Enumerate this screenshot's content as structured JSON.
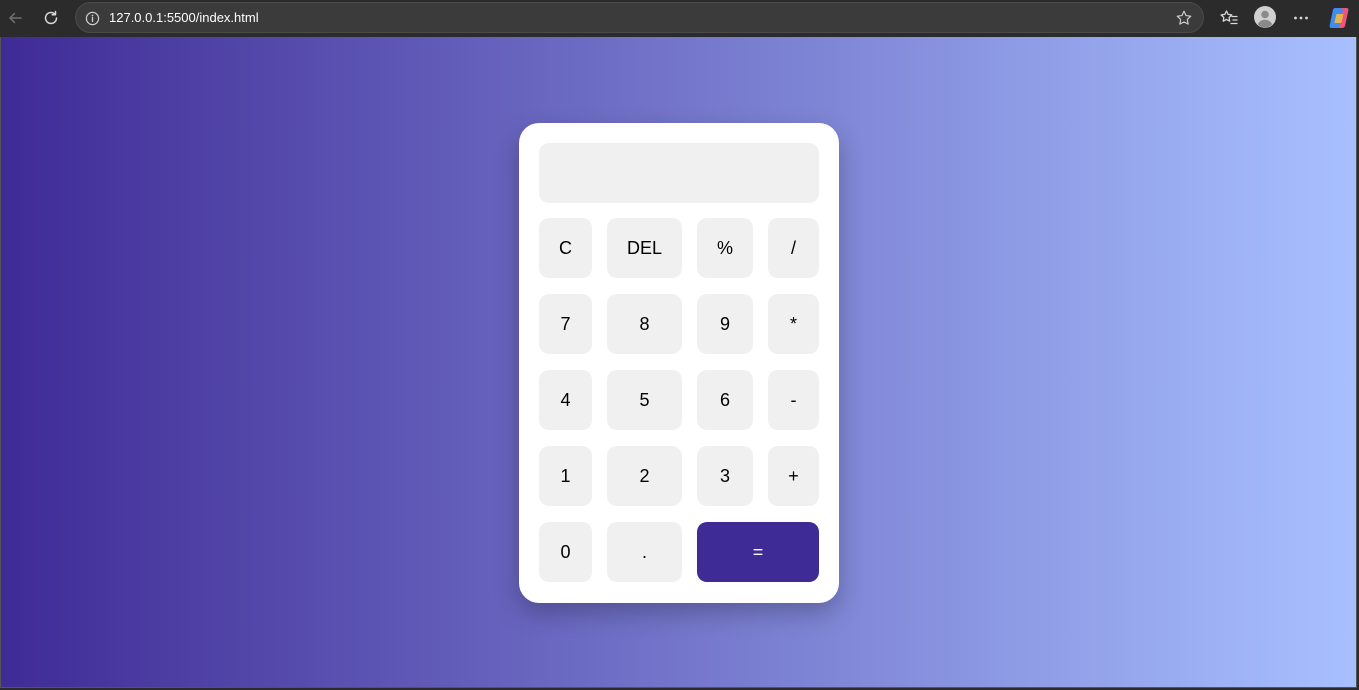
{
  "browser": {
    "url": "127.0.0.1:5500/index.html",
    "icons": {
      "back": "back-arrow-icon",
      "reload": "reload-icon",
      "info": "info-icon",
      "favorite": "star-icon",
      "favorites": "favorites-icon",
      "profile": "profile-avatar-icon",
      "menu": "more-menu-icon",
      "copilot": "copilot-icon"
    }
  },
  "page": {
    "gradient_start": "#3f2b96",
    "gradient_end": "#a8c0ff"
  },
  "calculator": {
    "display_value": "",
    "accent": "#3f2b96",
    "keys": {
      "clear": "C",
      "delete": "DEL",
      "percent": "%",
      "divide": "/",
      "seven": "7",
      "eight": "8",
      "nine": "9",
      "multiply": "*",
      "four": "4",
      "five": "5",
      "six": "6",
      "subtract": "-",
      "one": "1",
      "two": "2",
      "three": "3",
      "add": "+",
      "zero": "0",
      "decimal": ".",
      "equals": "="
    }
  }
}
